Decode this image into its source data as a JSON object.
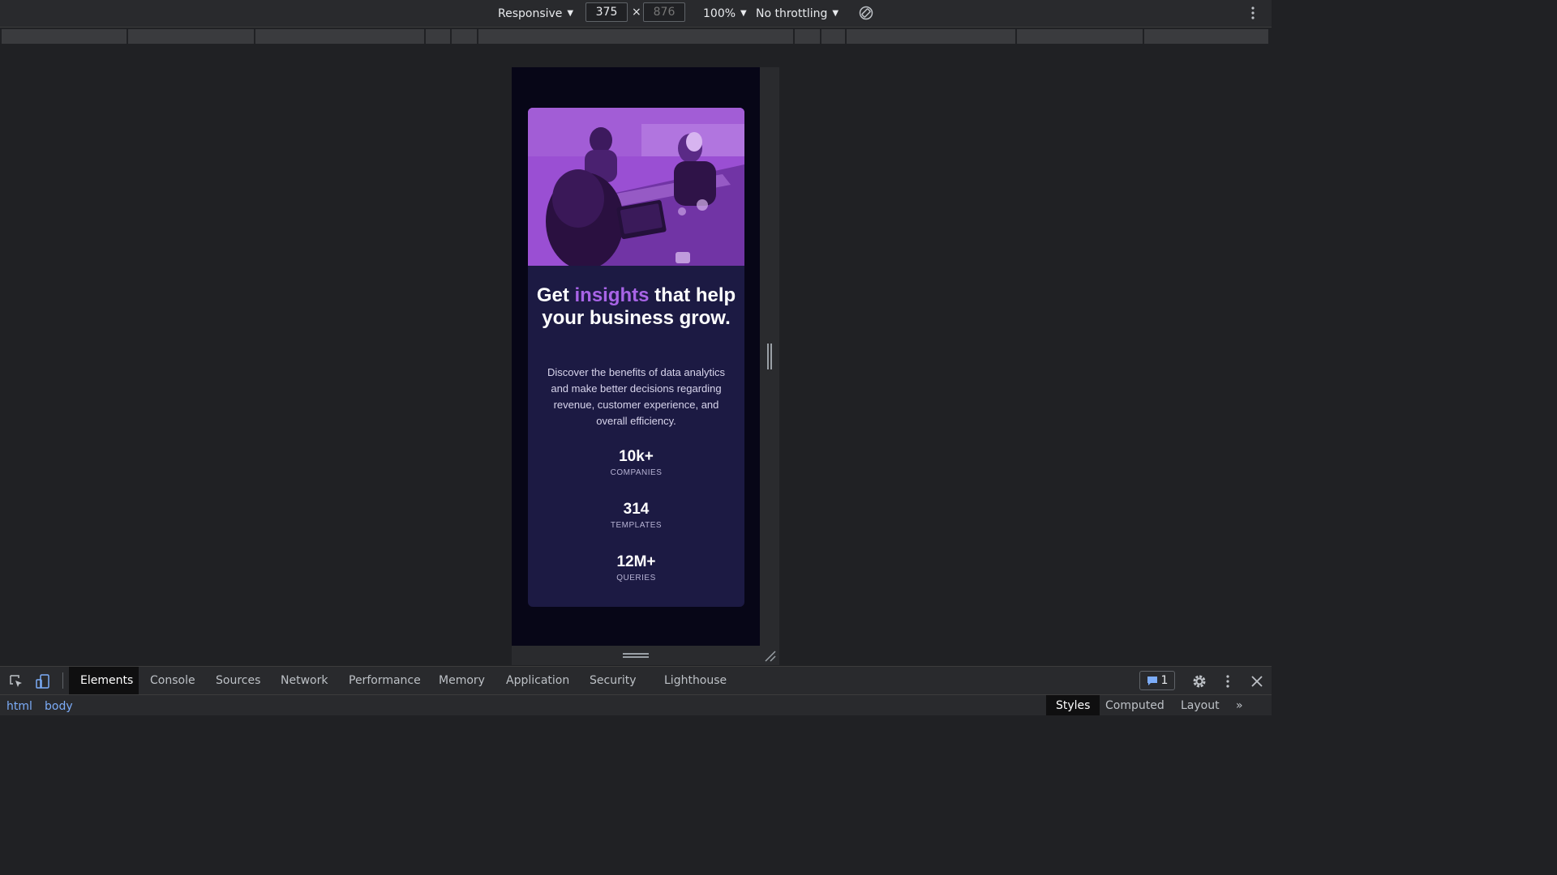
{
  "toolbar": {
    "device": "Responsive",
    "width": "375",
    "height": "876",
    "zoom": "100%",
    "throttling": "No throttling",
    "rotate_icon": "rotate-icon",
    "more_icon": "kebab-icon"
  },
  "page": {
    "headline_pre": "Get ",
    "headline_accent": "insights",
    "headline_post": " that help your business grow.",
    "description": "Discover the benefits of data analytics and make better decisions regarding revenue, customer experience, and overall efficiency.",
    "stats": [
      {
        "value": "10k+",
        "label": "COMPANIES"
      },
      {
        "value": "314",
        "label": "TEMPLATES"
      },
      {
        "value": "12M+",
        "label": "QUERIES"
      }
    ],
    "colors": {
      "accent": "#a864e6",
      "card": "#1c1a43",
      "background": "#070617"
    }
  },
  "devtools": {
    "tabs": [
      "Elements",
      "Console",
      "Sources",
      "Network",
      "Performance",
      "Memory",
      "Application",
      "Security",
      "Lighthouse"
    ],
    "active_tab": "Elements",
    "issues_count": "1",
    "breadcrumbs": [
      "html",
      "body"
    ],
    "side_tabs": [
      "Styles",
      "Computed",
      "Layout"
    ],
    "side_more": "»"
  }
}
